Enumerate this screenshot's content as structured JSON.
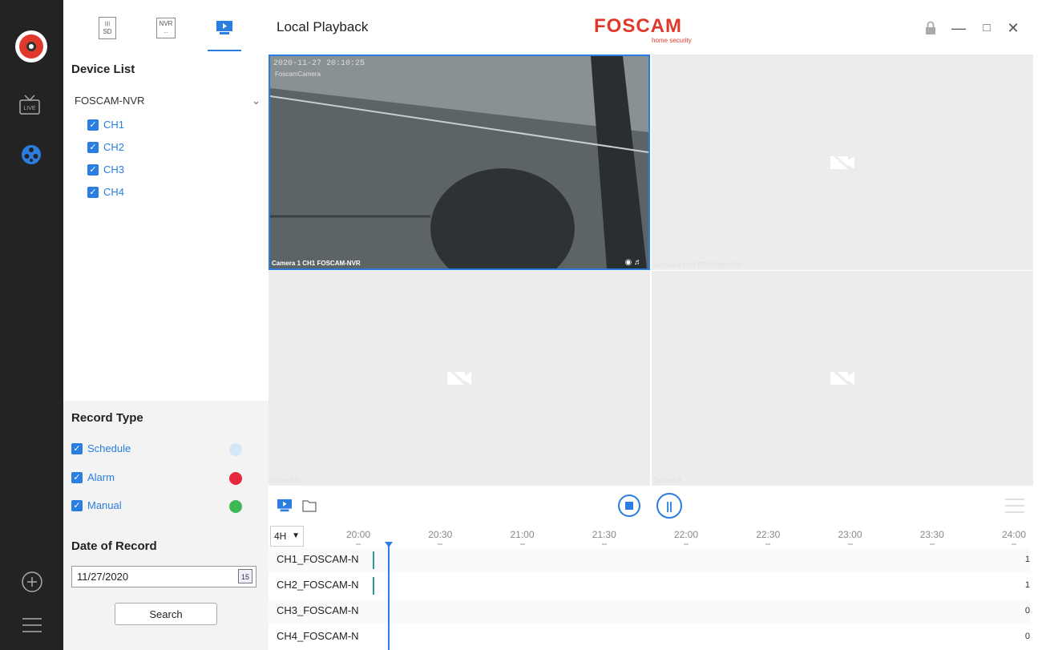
{
  "window": {
    "title": "Local Playback"
  },
  "brand": {
    "name": "FOSCAM",
    "tagline": "home security",
    "color": "#e0392b"
  },
  "colors": {
    "accent": "#2a7de1",
    "schedule": "#d6e6f9",
    "alarm": "#e8283c",
    "manual": "#3cb857"
  },
  "rail": {
    "live_label": "LIVE"
  },
  "source_tabs": {
    "sd": "SD",
    "nvr": "NVR"
  },
  "device_list": {
    "title": "Device List",
    "device": "FOSCAM-NVR",
    "channels": [
      "CH1",
      "CH2",
      "CH3",
      "CH4"
    ]
  },
  "record_type": {
    "title": "Record Type",
    "items": [
      "Schedule",
      "Alarm",
      "Manual"
    ]
  },
  "date_of_record": {
    "title": "Date of Record",
    "value": "11/27/2020",
    "calendar_day": "15",
    "search_label": "Search"
  },
  "video": {
    "osd_time": "2020-11-27 20:10:25",
    "osd_name": "FoscamCamera",
    "tiles": [
      "Camera 1 CH1 FOSCAM-NVR",
      "Camera 2 CH2 FOSCAM-NVR",
      "Camera 3",
      "Camera 4"
    ]
  },
  "timeline": {
    "span": "4H",
    "ticks": [
      "20:00",
      "20:30",
      "21:00",
      "21:30",
      "22:00",
      "22:30",
      "23:00",
      "23:30",
      "24:00"
    ],
    "tracks": [
      {
        "name": "CH1_FOSCAM-N",
        "count": "1"
      },
      {
        "name": "CH2_FOSCAM-N",
        "count": "1"
      },
      {
        "name": "CH3_FOSCAM-N",
        "count": "0"
      },
      {
        "name": "CH4_FOSCAM-N",
        "count": "0"
      }
    ]
  }
}
